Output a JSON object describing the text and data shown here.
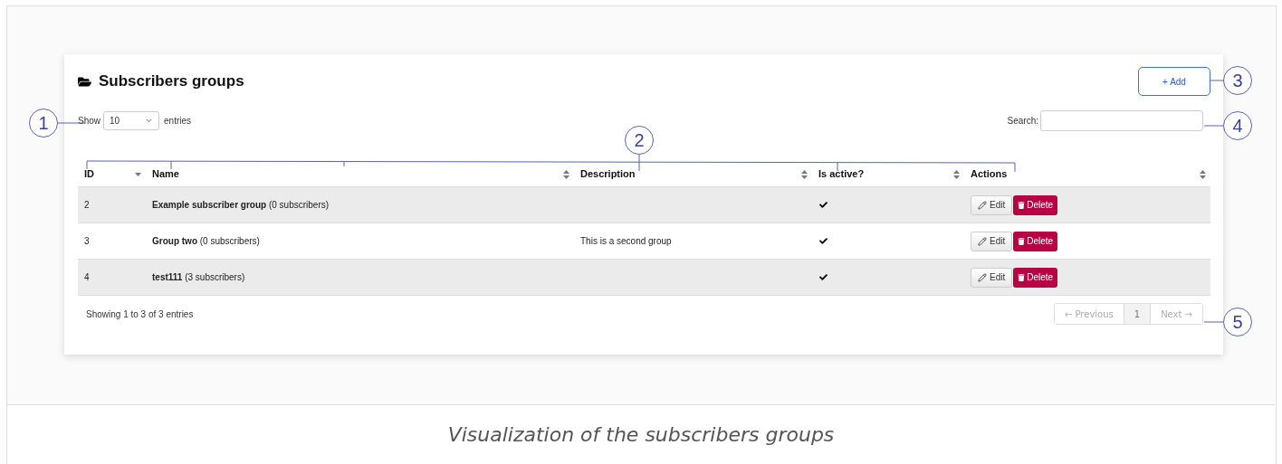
{
  "card": {
    "title": "Subscribers groups",
    "add_button": "+ Add"
  },
  "length_control": {
    "show_label": "Show",
    "value": "10",
    "entries_label": "entries"
  },
  "search": {
    "label": "Search:"
  },
  "table": {
    "columns": [
      {
        "label": "ID",
        "sorted": true
      },
      {
        "label": "Name",
        "sorted": false
      },
      {
        "label": "Description",
        "sorted": false
      },
      {
        "label": "Is active?",
        "sorted": false
      },
      {
        "label": "Actions",
        "sorted": false
      }
    ],
    "rows": [
      {
        "id": "2",
        "name": "**Example subscriber group** (0 subscribers)",
        "active": true,
        "edit": "Edit",
        "delete": "Delete"
      },
      {
        "id": "3",
        "name": "**Group two** (0 subscribers)",
        "description": "This is a second group",
        "active": true,
        "edit": "Edit",
        "delete": "Delete"
      },
      {
        "id": "4",
        "name": "**test111** (3 subscribers)",
        "active": true,
        "edit": "Edit",
        "delete": "Delete"
      }
    ]
  },
  "info": "Showing 1 to 3 of 3 entries",
  "pagination": [
    {
      "label": "← Previous",
      "disabled": true,
      "selected": false
    },
    {
      "label": "1",
      "disabled": false,
      "selected": true
    },
    {
      "label": "Next →",
      "disabled": true,
      "selected": false
    }
  ],
  "callouts": [
    {
      "label": "1"
    },
    {
      "label": "2"
    },
    {
      "label": "3"
    },
    {
      "label": "4"
    },
    {
      "label": "5"
    }
  ],
  "caption": "Visualization of the subscribers groups"
}
